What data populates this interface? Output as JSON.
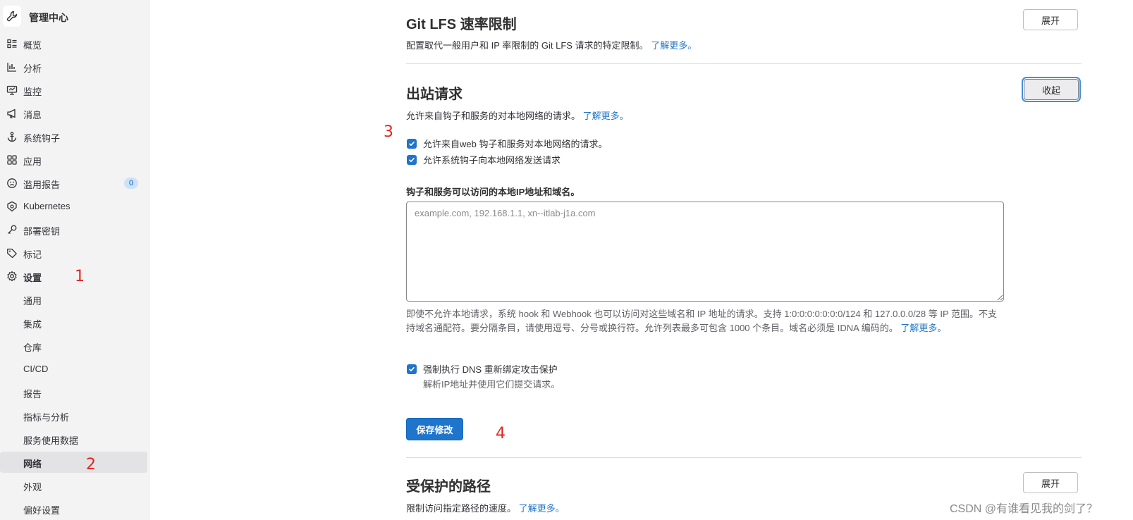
{
  "sidebar": {
    "title": "管理中心",
    "items": [
      {
        "label": "概览",
        "icon": "overview-icon"
      },
      {
        "label": "分析",
        "icon": "chart-icon"
      },
      {
        "label": "监控",
        "icon": "monitor-icon"
      },
      {
        "label": "消息",
        "icon": "bullhorn-icon"
      },
      {
        "label": "系统钩子",
        "icon": "anchor-icon"
      },
      {
        "label": "应用",
        "icon": "apps-icon"
      },
      {
        "label": "滥用报告",
        "icon": "abuse-icon",
        "badge": "0"
      },
      {
        "label": "Kubernetes",
        "icon": "kubernetes-icon"
      },
      {
        "label": "部署密钥",
        "icon": "key-icon"
      },
      {
        "label": "标记",
        "icon": "label-icon"
      },
      {
        "label": "设置",
        "icon": "settings-icon"
      }
    ],
    "settings_children": [
      "通用",
      "集成",
      "仓库",
      "CI/CD",
      "报告",
      "指标与分析",
      "服务使用数据",
      "网络",
      "外观",
      "偏好设置"
    ],
    "active_item": "网络"
  },
  "annotations": [
    "1",
    "2",
    "3",
    "4"
  ],
  "sections": {
    "git_lfs": {
      "title": "Git LFS 速率限制",
      "desc": "配置取代一般用户和 IP 率限制的 Git LFS 请求的特定限制。",
      "link": "了解更多。",
      "button": "展开"
    },
    "outbound": {
      "title": "出站请求",
      "desc": "允许来自钩子和服务的对本地网络的请求。",
      "link": "了解更多。",
      "button": "收起",
      "checkbox_webhooks": "允许来自web 钩子和服务对本地网络的请求。",
      "checkbox_system_hooks": "允许系统钩子向本地网络发送请求",
      "allowlist_label": "钩子和服务可以访问的本地IP地址和域名。",
      "allowlist_placeholder": "example.com, 192.168.1.1, xn--itlab-j1a.com",
      "help_text": "即使不允许本地请求，系统 hook 和 Webhook 也可以访问对这些域名和 IP 地址的请求。支持 1:0:0:0:0:0:0:0/124 和 127.0.0.0/28 等 IP 范围。不支持域名通配符。要分隔条目，请使用逗号、分号或换行符。允许列表最多可包含 1000 个条目。域名必须是 IDNA 编码的。",
      "help_link": "了解更多。",
      "dns_checkbox": "强制执行 DNS 重新绑定攻击保护",
      "dns_help": "解析IP地址并使用它们提交请求。",
      "save_button": "保存修改"
    },
    "protected_paths": {
      "title": "受保护的路径",
      "desc": "限制访问指定路径的速度。",
      "link": "了解更多。",
      "button": "展开"
    }
  },
  "watermark": "CSDN @有谁看见我的剑了？",
  "colors": {
    "accent": "#1f75cb",
    "annotation": "#e0261f",
    "sidebar_bg": "#f3f3f4"
  }
}
